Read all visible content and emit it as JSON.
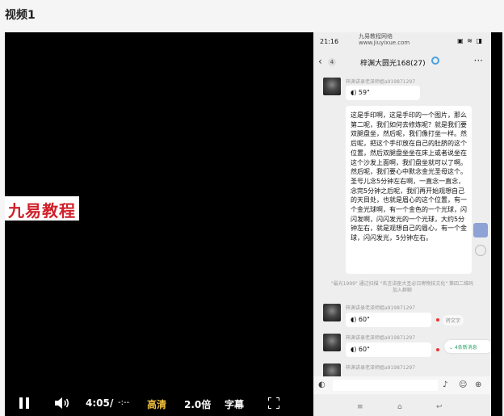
{
  "page": {
    "title": "视频1"
  },
  "player": {
    "watermark_text": "九易教程",
    "controls": {
      "current_time": "4:05",
      "separator": "/",
      "duration": "-:--",
      "quality": "高清",
      "quality_color": "#f0c040",
      "speed": "2.0倍",
      "subtitles": "字幕"
    }
  },
  "phone": {
    "status": {
      "time": "21:16",
      "site_watermark": "九易教程网络\nwww.jiuyixue.com",
      "icons": "▣ ≋ ◨"
    },
    "chat": {
      "back_count": "4",
      "title": "梓渊大圆光168(27)",
      "messages": [
        {
          "sender": "梓渊讲录老泽师姐a919871297",
          "voice": "59\""
        },
        {
          "text": "这是手印啊，这是手印的一个图片，那么第二呢，我们如何去修炼呢？就是我们要双腿盘坐，然后呢，我们像打坐一样。然后呢，把这个手印放在自己的肚脐的这个位置，然后双腿盘坐坐在床上或者说坐在这个沙发上面啊，我们盘坐就可以了啊。然后呢，我们要心中默念金光圣母这个。圣号儿念5分钟左右啊，一直念一直念，念完5分钟之后呢，我们再开始观想自己的天目处，也就是眉心的这个位置，有一个金光球啊，有一个金色的一个光球，闪闪发啊，闪闪发光的一个光球，大约5分钟左右，就是观想自己的眉心，有一个金球，闪闪发光，5分钟左右。"
        },
        {
          "system": "\"最光1999\" 通过扫描 \"名言讲座大圣必日寄物技文化\" 第四二维码加入群聊"
        },
        {
          "sender": "梓渊讲录老泽师姐a919871297",
          "voice": "60\"",
          "convert": "转文字"
        },
        {
          "sender": "梓渊讲录老泽师姐a919871297",
          "voice": "60\""
        },
        {
          "sender": "梓渊讲录老泽师姐a919871297"
        }
      ],
      "new_messages": "⌄ 4条新消息"
    }
  }
}
